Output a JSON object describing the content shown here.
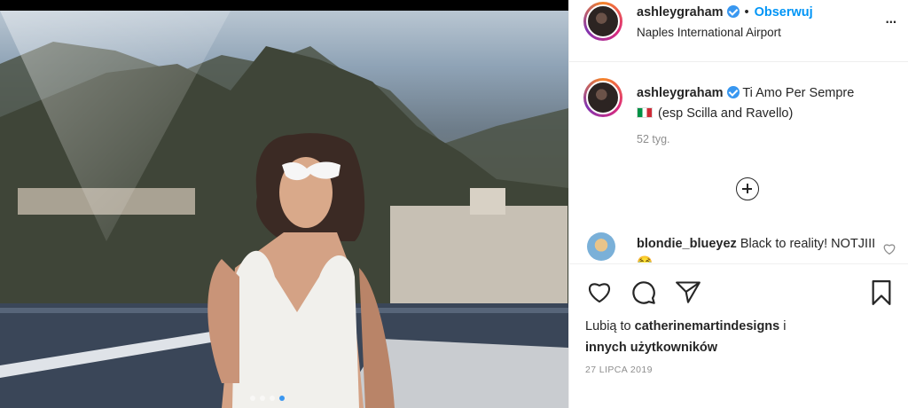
{
  "post": {
    "photo_alt": "",
    "carousel": {
      "count": 4,
      "active_index": 3
    }
  },
  "header": {
    "username": "ashleygraham",
    "bullet": "•",
    "follow_label": "Obserwuj",
    "location": "Naples International Airport",
    "more_label": "..."
  },
  "caption": {
    "username": "ashleygraham",
    "text_line1": "Ti Amo Per Sempre",
    "text_line2": "(esp Scilla and Ravello)",
    "time": "52 tyg."
  },
  "comment": {
    "username": "blondie_blueyez",
    "text": "Black to reality! NOTJIII😂"
  },
  "likes": {
    "prefix": "Lubią to",
    "user": "catherinemartindesigns",
    "connector": "i",
    "others": "innych użytkowników"
  },
  "date": "27 LIPCA 2019",
  "icons": [
    "heart-icon",
    "comment-icon",
    "share-icon",
    "bookmark-icon",
    "add-circle-icon",
    "verified-icon"
  ],
  "colors": {
    "accent": "#0095f6",
    "verified": "#3897f0",
    "muted": "#8e8e8e",
    "text": "#262626"
  }
}
